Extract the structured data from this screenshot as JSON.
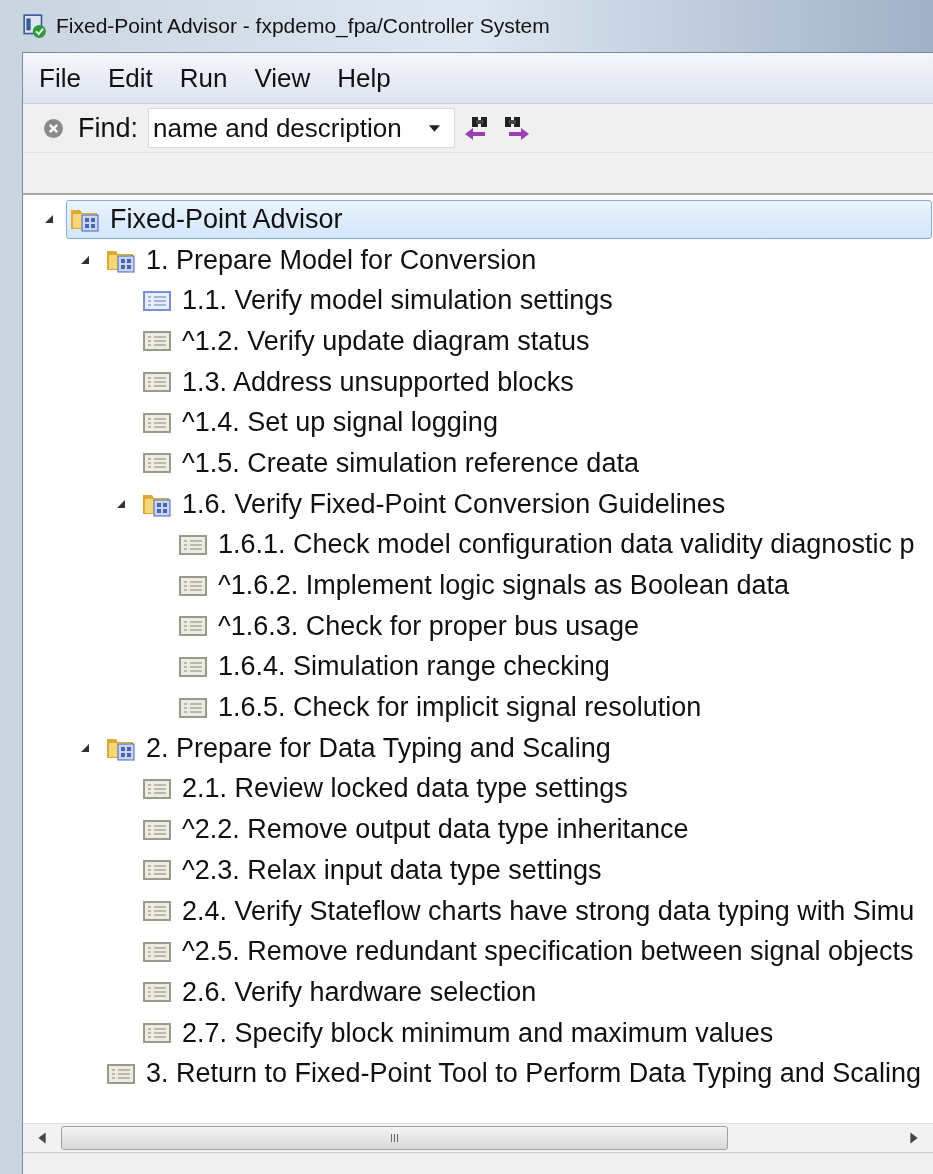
{
  "window": {
    "title": "Fixed-Point Advisor - fxpdemo_fpa/Controller System"
  },
  "menu": [
    "File",
    "Edit",
    "Run",
    "View",
    "Help"
  ],
  "find": {
    "label": "Find:",
    "value": "name and description"
  },
  "tree": [
    {
      "label": "Fixed-Point Advisor",
      "kind": "folder",
      "expanded": true,
      "selected": true,
      "children": [
        {
          "label": "1. Prepare Model for Conversion",
          "kind": "folder",
          "expanded": true,
          "selected": false,
          "children": [
            {
              "label": "1.1. Verify model simulation settings",
              "kind": "task-blue",
              "selected": false
            },
            {
              "label": "^1.2. Verify update diagram status",
              "kind": "task",
              "selected": false
            },
            {
              "label": "1.3. Address unsupported blocks",
              "kind": "task",
              "selected": false
            },
            {
              "label": "^1.4. Set up signal logging",
              "kind": "task",
              "selected": false
            },
            {
              "label": "^1.5. Create simulation reference data",
              "kind": "task",
              "selected": false
            },
            {
              "label": "1.6. Verify Fixed-Point Conversion Guidelines",
              "kind": "folder",
              "expanded": true,
              "selected": false,
              "children": [
                {
                  "label": "1.6.1. Check model configuration data validity diagnostic p",
                  "kind": "task",
                  "selected": false
                },
                {
                  "label": "^1.6.2. Implement logic signals as Boolean data",
                  "kind": "task",
                  "selected": false
                },
                {
                  "label": "^1.6.3. Check for proper bus usage",
                  "kind": "task",
                  "selected": false
                },
                {
                  "label": "1.6.4. Simulation range checking",
                  "kind": "task",
                  "selected": false
                },
                {
                  "label": "1.6.5. Check for implicit signal resolution",
                  "kind": "task",
                  "selected": false
                }
              ]
            }
          ]
        },
        {
          "label": "2. Prepare for Data Typing and Scaling",
          "kind": "folder",
          "expanded": true,
          "selected": false,
          "children": [
            {
              "label": "2.1. Review locked data type settings",
              "kind": "task",
              "selected": false
            },
            {
              "label": "^2.2. Remove output data type inheritance",
              "kind": "task",
              "selected": false
            },
            {
              "label": "^2.3. Relax input data type settings",
              "kind": "task",
              "selected": false
            },
            {
              "label": "2.4. Verify Stateflow charts have strong data typing with Simu",
              "kind": "task",
              "selected": false
            },
            {
              "label": "^2.5. Remove redundant specification between signal objects",
              "kind": "task",
              "selected": false
            },
            {
              "label": "2.6. Verify hardware selection",
              "kind": "task",
              "selected": false
            },
            {
              "label": "2.7. Specify block minimum and maximum values",
              "kind": "task",
              "selected": false
            }
          ]
        },
        {
          "label": "3. Return to Fixed-Point Tool to Perform Data Typing and Scaling",
          "kind": "task",
          "selected": false
        }
      ]
    }
  ]
}
